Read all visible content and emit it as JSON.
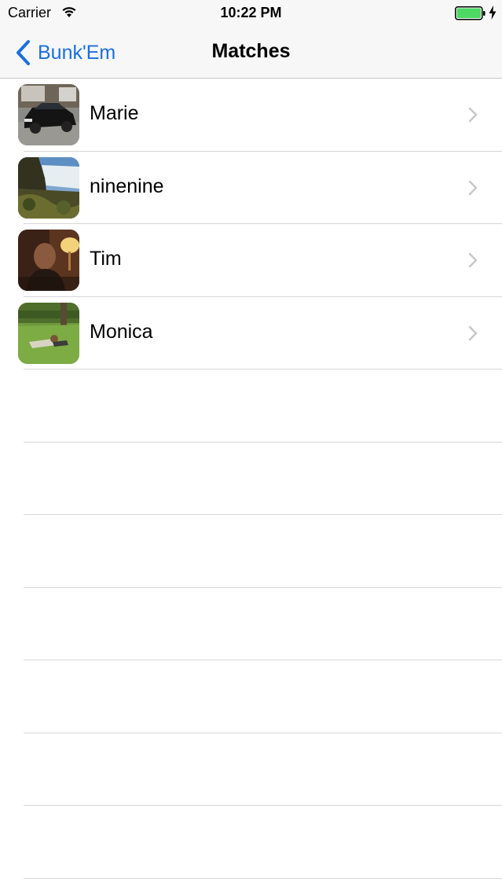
{
  "status_bar": {
    "carrier": "Carrier",
    "time": "10:22 PM",
    "battery_color": "#4cd964"
  },
  "nav": {
    "back_label": "Bunk'Em",
    "title": "Matches",
    "tint_color": "#1a6fe0"
  },
  "matches": [
    {
      "name": "Marie",
      "photo": "car-photo"
    },
    {
      "name": "ninenine",
      "photo": "waterfall-photo"
    },
    {
      "name": "Tim",
      "photo": "person-indoor-photo"
    },
    {
      "name": "Monica",
      "photo": "person-lawn-photo"
    }
  ]
}
